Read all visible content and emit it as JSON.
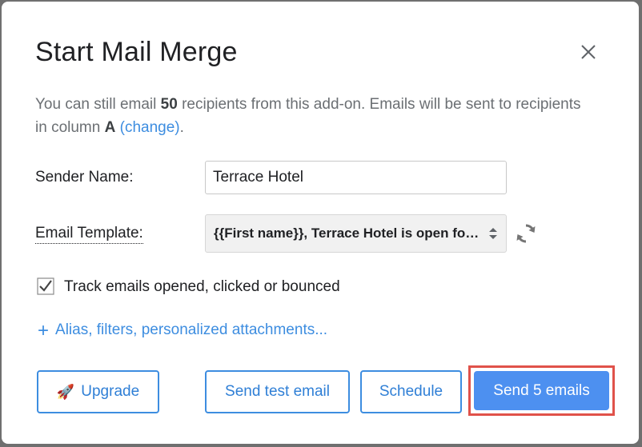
{
  "dialog": {
    "title": "Start Mail Merge",
    "close_icon": "close-icon",
    "info": {
      "part1": "You can still email ",
      "count": "50",
      "part2": " recipients from this add-on. Emails will be sent to recipients in column ",
      "column": "A",
      "part3": " ",
      "change_link": "(change)",
      "part4": "."
    },
    "sender": {
      "label": "Sender Name:",
      "value": "Terrace Hotel"
    },
    "template": {
      "label": "Email Template:",
      "selected": "{{First name}}, Terrace Hotel is open for the season!",
      "arrows_icon": "select-arrows-icon",
      "refresh_icon": "refresh-icon"
    },
    "tracking": {
      "checked": true,
      "label": "Track emails opened, clicked or bounced"
    },
    "more_options": {
      "plus": "+",
      "label": "Alias, filters, personalized attachments..."
    },
    "buttons": {
      "upgrade_icon": "🚀",
      "upgrade": "Upgrade",
      "test": "Send test email",
      "schedule": "Schedule",
      "send": "Send 5 emails"
    },
    "colors": {
      "accent": "#3d8de0",
      "primary_button": "#4d90f0",
      "highlight": "#e0524a"
    }
  }
}
